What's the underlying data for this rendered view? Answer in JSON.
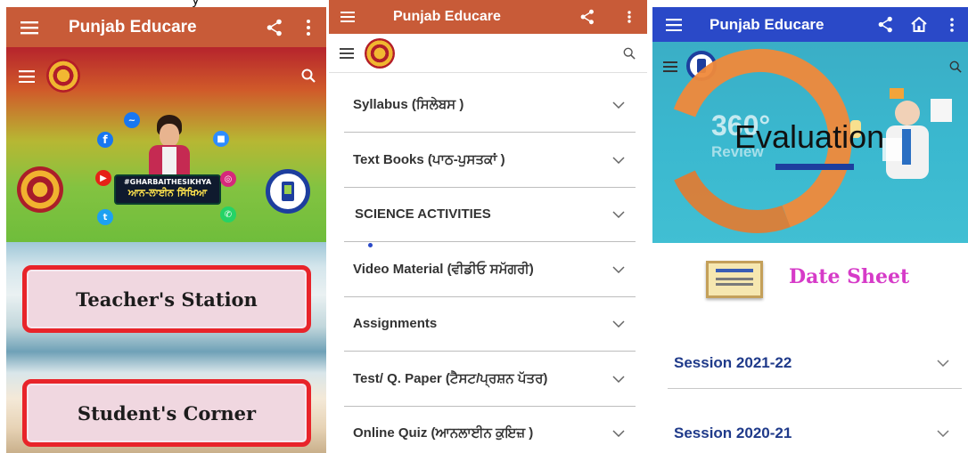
{
  "app": {
    "title": "Punjab Educare"
  },
  "colors": {
    "appbar_orange": "#c85b38",
    "appbar_blue": "#2a49c8",
    "button_border": "#e8242a",
    "date_sheet": "#d63bc8",
    "session": "#1f3a8a"
  },
  "icons": {
    "menu": "menu-icon",
    "share": "share-icon",
    "more": "more-vert-icon",
    "home": "home-icon",
    "search": "search-icon",
    "chevron": "chevron-down-icon"
  },
  "screen1": {
    "hero": {
      "hashtag": "#GHARBAITHESIKHYA",
      "tagline": "ਆਨ-ਲਾਈਨ ਸਿੱਖਿਆ"
    },
    "teacher_btn": "Teacher's Station",
    "student_btn": "Student's Corner"
  },
  "screen2": {
    "items": [
      {
        "label": "Syllabus (ਸਿਲੇਬਸ )"
      },
      {
        "label": "Text Books (ਪਾਠ-ਪੁਸਤਕਾਂ )"
      },
      {
        "label": "SCIENCE ACTIVITIES"
      },
      {
        "label": "Video Material (ਵੀਡੀਓ ਸਮੱਗਰੀ)"
      },
      {
        "label": "Assignments"
      },
      {
        "label": "Test/ Q. Paper (ਟੈਸਟ/ਪ੍ਰਸ਼ਨ ਪੱਤਰ)"
      },
      {
        "label": "Online Quiz (ਆਨਲਾਈਨ ਕੁਇਜ਼ )"
      }
    ]
  },
  "screen3": {
    "banner": {
      "title": "Evaluation",
      "number": "360°",
      "sub": "Review"
    },
    "date_sheet": "Date Sheet",
    "sessions": [
      {
        "label": "Session 2021-22"
      },
      {
        "label": "Session 2020-21"
      }
    ]
  }
}
